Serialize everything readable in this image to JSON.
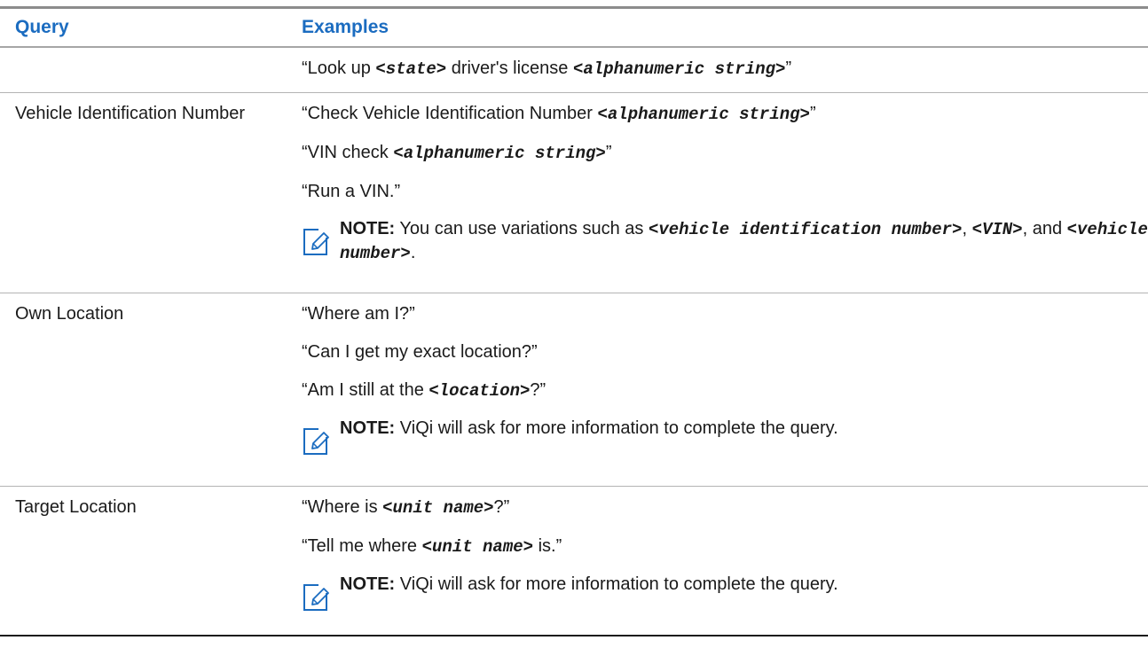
{
  "header": {
    "query": "Query",
    "examples": "Examples"
  },
  "rows": [
    {
      "query": "",
      "examples": [
        {
          "pre": "“Look up ",
          "v1": "<state>",
          "mid": " driver's license ",
          "v2": "<alphanumeric string>",
          "post": "”"
        }
      ]
    },
    {
      "query": "Vehicle Identification Number",
      "examples": [
        {
          "pre": "“Check Vehicle Identification Number ",
          "v1": "<alphanumeric string>",
          "post": "”"
        },
        {
          "pre": "“VIN check ",
          "v1": "<alphanumeric string>",
          "post": "”"
        },
        {
          "pre": "“Run a VIN.”"
        }
      ],
      "note": {
        "label": "NOTE:",
        "text1": " You can use variations such as ",
        "v1": "<vehicle identification number>",
        "sep1": ", ",
        "v2": "<VIN>",
        "sep2": ", and ",
        "v3": "<vehicle number>",
        "end": "."
      }
    },
    {
      "query": "Own Location",
      "examples": [
        {
          "pre": "“Where am I?”"
        },
        {
          "pre": "“Can I get my exact location?”"
        },
        {
          "pre": "“Am I still at the ",
          "v1": "<location>",
          "post": "?”"
        }
      ],
      "note": {
        "label": "NOTE:",
        "text1": " ViQi will ask for more information to complete the query."
      }
    },
    {
      "query": "Target Location",
      "examples": [
        {
          "pre": "“Where is ",
          "v1": "<unit name>",
          "post": "?”"
        },
        {
          "pre": "“Tell me where ",
          "v1": "<unit name>",
          "post": " is.”"
        }
      ],
      "note": {
        "label": "NOTE:",
        "text1": " ViQi will ask for more information to complete the query."
      }
    }
  ],
  "colors": {
    "header_text": "#1b6cc0",
    "note_icon": "#1b6cc0"
  },
  "icons": {
    "note": "note-pencil-icon"
  }
}
